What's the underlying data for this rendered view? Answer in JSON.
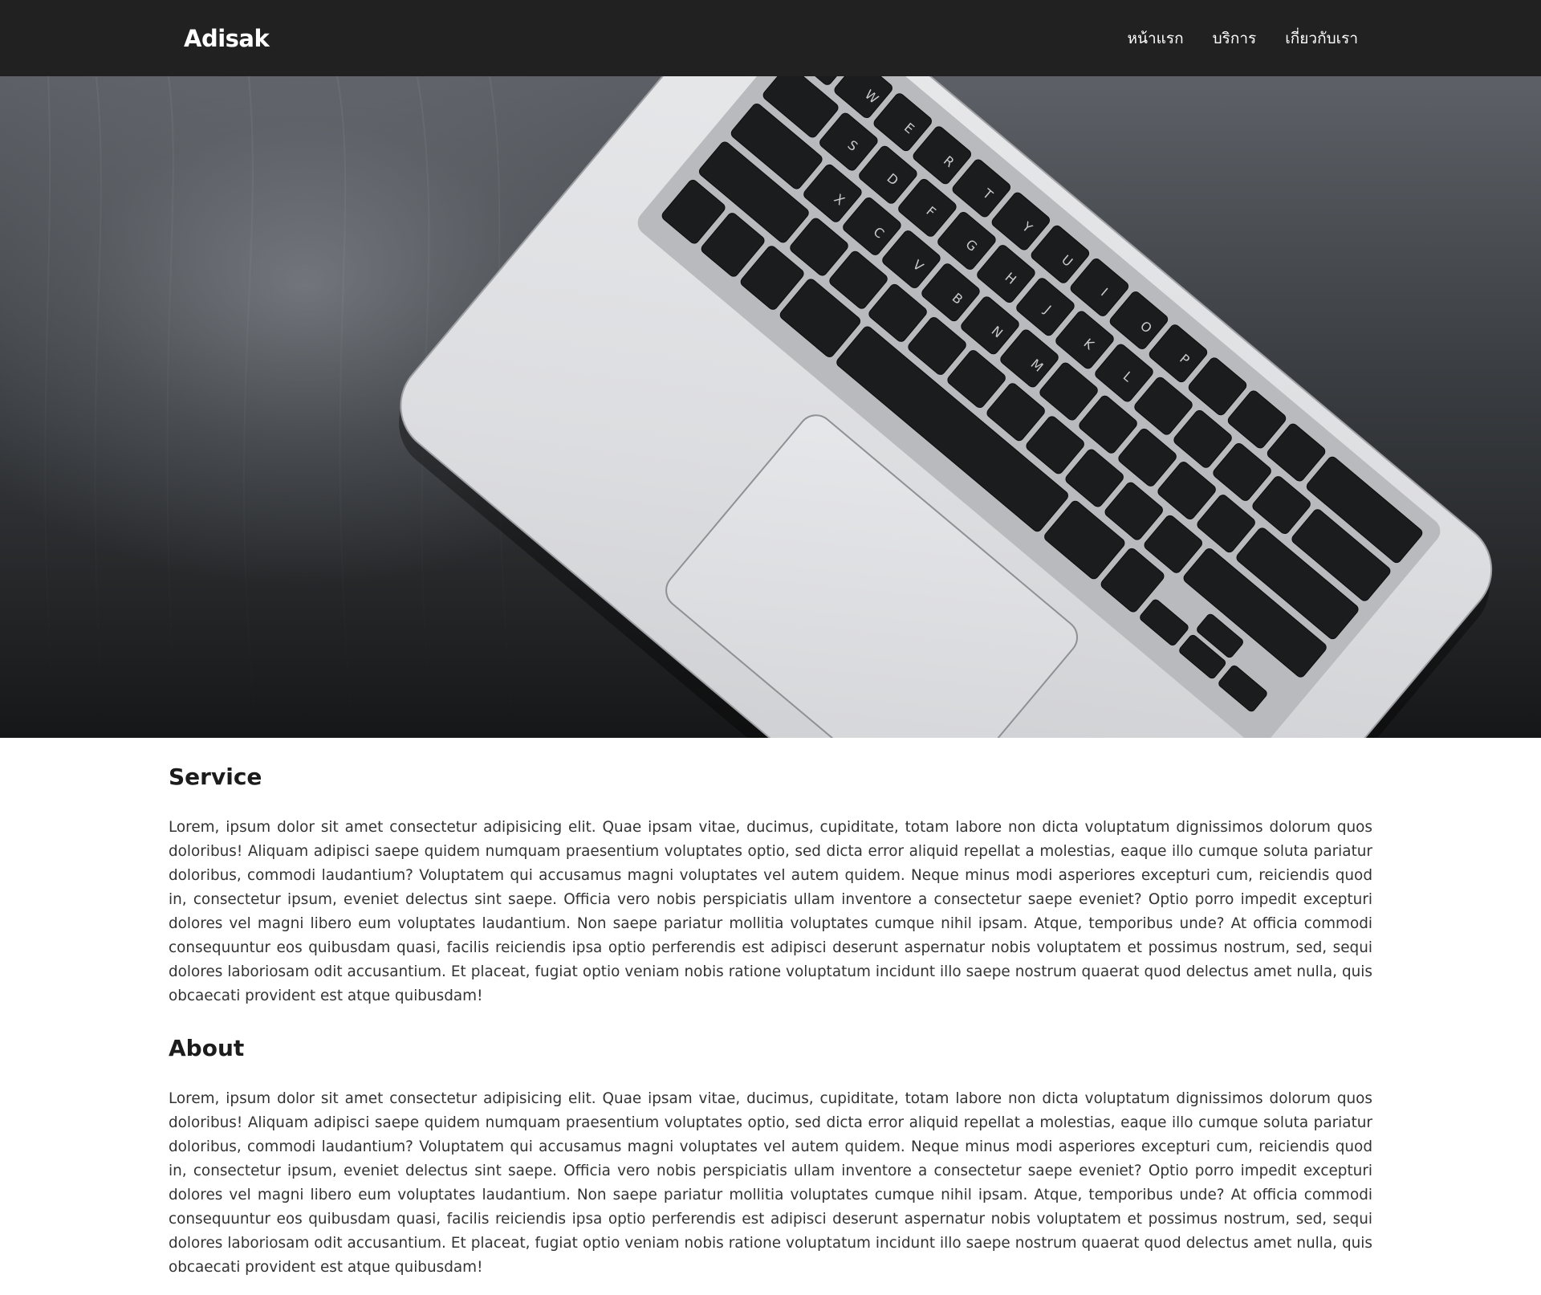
{
  "navbar": {
    "brand": "Adisak",
    "links": [
      {
        "label": "หน้าแรก"
      },
      {
        "label": "บริการ"
      },
      {
        "label": "เกี่ยวกับเรา"
      }
    ]
  },
  "hero": {
    "image_subject": "Silver laptop keyboard and trackpad on a dark wooden desk",
    "icon": "laptop-photo"
  },
  "sections": [
    {
      "title": "Service",
      "text": "Lorem, ipsum dolor sit amet consectetur adipisicing elit. Quae ipsam vitae, ducimus, cupiditate, totam labore non dicta voluptatum dignissimos dolorum quos doloribus! Aliquam adipisci saepe quidem numquam praesentium voluptates optio, sed dicta error aliquid repellat a molestias, eaque illo cumque soluta pariatur doloribus, commodi laudantium? Voluptatem qui accusamus magni voluptates vel autem quidem. Neque minus modi asperiores excepturi cum, reiciendis quod in, consectetur ipsum, eveniet delectus sint saepe. Officia vero nobis perspiciatis ullam inventore a consectetur saepe eveniet? Optio porro impedit excepturi dolores vel magni libero eum voluptates laudantium. Non saepe pariatur mollitia voluptates cumque nihil ipsam. Atque, temporibus unde? At officia commodi consequuntur eos quibusdam quasi, facilis reiciendis ipsa optio perferendis est adipisci deserunt aspernatur nobis voluptatem et possimus nostrum, sed, sequi dolores laboriosam odit accusantium. Et placeat, fugiat optio veniam nobis ratione voluptatum incidunt illo saepe nostrum quaerat quod delectus amet nulla, quis obcaecati provident est atque quibusdam!"
    },
    {
      "title": "About",
      "text": "Lorem, ipsum dolor sit amet consectetur adipisicing elit. Quae ipsam vitae, ducimus, cupiditate, totam labore non dicta voluptatum dignissimos dolorum quos doloribus! Aliquam adipisci saepe quidem numquam praesentium voluptates optio, sed dicta error aliquid repellat a molestias, eaque illo cumque soluta pariatur doloribus, commodi laudantium? Voluptatem qui accusamus magni voluptates vel autem quidem. Neque minus modi asperiores excepturi cum, reiciendis quod in, consectetur ipsum, eveniet delectus sint saepe. Officia vero nobis perspiciatis ullam inventore a consectetur saepe eveniet? Optio porro impedit excepturi dolores vel magni libero eum voluptates laudantium. Non saepe pariatur mollitia voluptates cumque nihil ipsam. Atque, temporibus unde? At officia commodi consequuntur eos quibusdam quasi, facilis reiciendis ipsa optio perferendis est adipisci deserunt aspernatur nobis voluptatem et possimus nostrum, sed, sequi dolores laboriosam odit accusantium. Et placeat, fugiat optio veniam nobis ratione voluptatum incidunt illo saepe nostrum quaerat quod delectus amet nulla, quis obcaecati provident est atque quibusdam!"
    }
  ],
  "colors": {
    "navbar_bg": "#212121",
    "nav_text": "#ffffff",
    "heading": "#1c1c1c",
    "body_text": "#333333"
  }
}
